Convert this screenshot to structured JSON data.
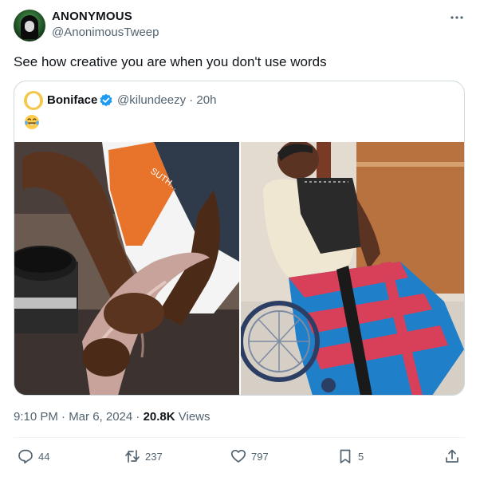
{
  "author": {
    "display_name": "ANONYMOUS",
    "handle": "@AnonimousTweep"
  },
  "tweet": {
    "text": "See how creative you are when you don't use words"
  },
  "quoted": {
    "display_name": "Boniface",
    "meta": "@kilundeezy · 20h",
    "emoji": "😂"
  },
  "timestamp": {
    "time": "9:10 PM · Mar 6, 2024 · ",
    "views_count": "20.8K",
    "views_label": " Views"
  },
  "actions": {
    "replies": "44",
    "reposts": "237",
    "likes": "797",
    "bookmarks": "5"
  },
  "colors": {
    "text_primary": "#0f1419",
    "text_secondary": "#536471",
    "verified": "#1d9bf0",
    "border": "#cfd9de"
  }
}
